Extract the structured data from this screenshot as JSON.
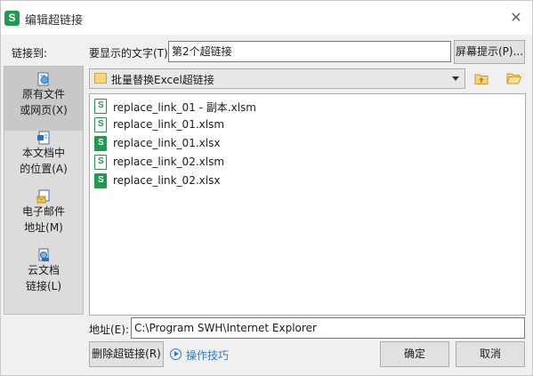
{
  "window": {
    "app_logo": "S",
    "title": "编辑超链接",
    "close_glyph": "✕"
  },
  "link_to_label": "链接到:",
  "display_text": {
    "label": "要显示的文字(T):",
    "value": "第2个超链接",
    "screentip_button": "屏幕提示(P)..."
  },
  "link_to_items": [
    {
      "line1": "原有文件",
      "line2": "或网页(X)",
      "icon": "web-page-icon",
      "selected": true
    },
    {
      "line1": "本文档中",
      "line2": "的位置(A)",
      "icon": "document-place-icon",
      "selected": false
    },
    {
      "line1": "电子邮件",
      "line2": "地址(M)",
      "icon": "email-address-icon",
      "selected": false
    },
    {
      "line1": "云文档",
      "line2": "链接(L)",
      "icon": "cloud-document-icon",
      "selected": false
    }
  ],
  "folder": {
    "current": "批量替换Excel超链接",
    "up_icon": "folder-up-icon",
    "browse_icon": "browse-folder-icon"
  },
  "files": [
    {
      "name": "replace_link_01 - 副本.xlsm",
      "type": "xlsm"
    },
    {
      "name": "replace_link_01.xlsm",
      "type": "xlsm"
    },
    {
      "name": "replace_link_01.xlsx",
      "type": "xlsx"
    },
    {
      "name": "replace_link_02.xlsm",
      "type": "xlsm"
    },
    {
      "name": "replace_link_02.xlsx",
      "type": "xlsx"
    }
  ],
  "address": {
    "label": "地址(E):",
    "value": "C:\\Program SWH\\Internet Explorer"
  },
  "buttons": {
    "remove_link": "删除超链接(R)",
    "tips": "操作技巧",
    "ok": "确定",
    "cancel": "取消"
  },
  "colors": {
    "accent_link": "#2a7bd1",
    "app_green": "#1f9b4f",
    "folder_yellow": "#f5d77b"
  }
}
